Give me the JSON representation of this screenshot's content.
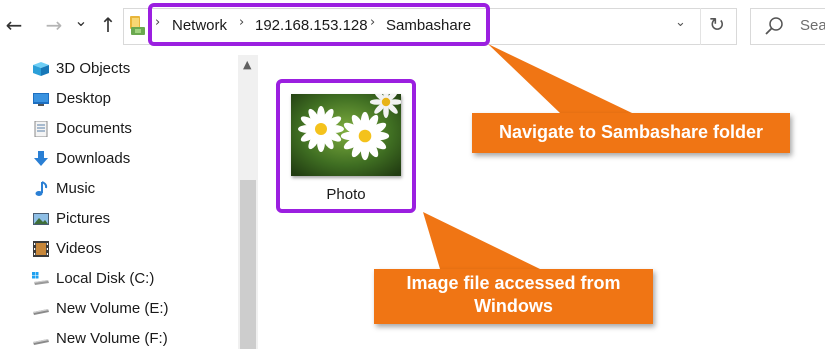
{
  "toolbar": {
    "back_icon": "back-arrow-icon",
    "forward_icon": "forward-arrow-icon",
    "recent_icon": "chevron-down-icon",
    "up_icon": "up-arrow-icon",
    "back_glyph": "←",
    "forward_glyph": "→",
    "recent_glyph": "⌄",
    "up_glyph": "↑",
    "breadcrumb": [
      "Network",
      "192.168.153.128",
      "Sambashare"
    ],
    "separator": "›",
    "dropdown_glyph": "⌄",
    "refresh_glyph": "↻",
    "search_placeholder": "Search"
  },
  "sidebar": {
    "items": [
      {
        "label": "3D Objects",
        "icon": "3d-objects-icon"
      },
      {
        "label": "Desktop",
        "icon": "desktop-icon"
      },
      {
        "label": "Documents",
        "icon": "documents-icon"
      },
      {
        "label": "Downloads",
        "icon": "downloads-icon"
      },
      {
        "label": "Music",
        "icon": "music-icon"
      },
      {
        "label": "Pictures",
        "icon": "pictures-icon"
      },
      {
        "label": "Videos",
        "icon": "videos-icon"
      },
      {
        "label": "Local Disk (C:)",
        "icon": "local-disk-icon"
      },
      {
        "label": "New Volume (E:)",
        "icon": "drive-icon"
      },
      {
        "label": "New Volume (F:)",
        "icon": "drive-icon"
      }
    ],
    "scroll_up_glyph": "▲"
  },
  "files": [
    {
      "name": "Photo",
      "thumbnail": "daisy-photo-thumbnail"
    }
  ],
  "annotations": {
    "callout_1": "Navigate to Sambashare folder",
    "callout_2_line1": "Image file accessed from",
    "callout_2_line2": "Windows"
  },
  "colors": {
    "highlight": "#9b1fe0",
    "callout": "#f07514",
    "callout_text": "#ffffff"
  }
}
